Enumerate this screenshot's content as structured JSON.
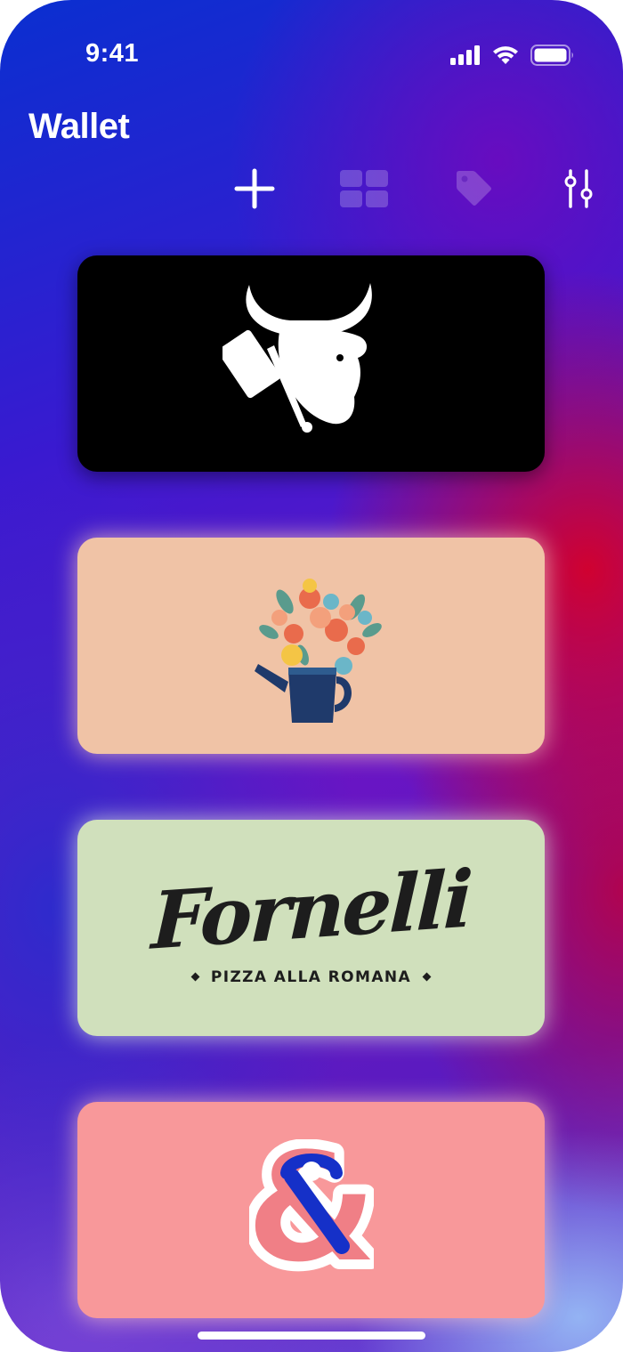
{
  "status_bar": {
    "time": "9:41"
  },
  "header": {
    "title": "Wallet"
  },
  "toolbar": {
    "buttons": [
      {
        "icon": "plus-icon"
      },
      {
        "icon": "grid-icon"
      },
      {
        "icon": "tag-icon"
      },
      {
        "icon": "sliders-icon"
      }
    ]
  },
  "cards": [
    {
      "brand_logo": "bull-head-cleaver-logo",
      "background": "#000000"
    },
    {
      "brand_logo": "flower-watering-can-logo",
      "background": "#f0c3a6"
    },
    {
      "brand_logo": "fornelli-logo",
      "background": "#d0e0bc",
      "wordmark": "Fornelli",
      "tagline": "PIZZA ALLA ROMANA"
    },
    {
      "brand_logo": "ampersand-logo",
      "background": "#f8989a"
    }
  ],
  "colors": {
    "accent_white": "#ffffff",
    "logo_navy": "#1f3a6b",
    "ampersand_blue": "#1530c8"
  }
}
